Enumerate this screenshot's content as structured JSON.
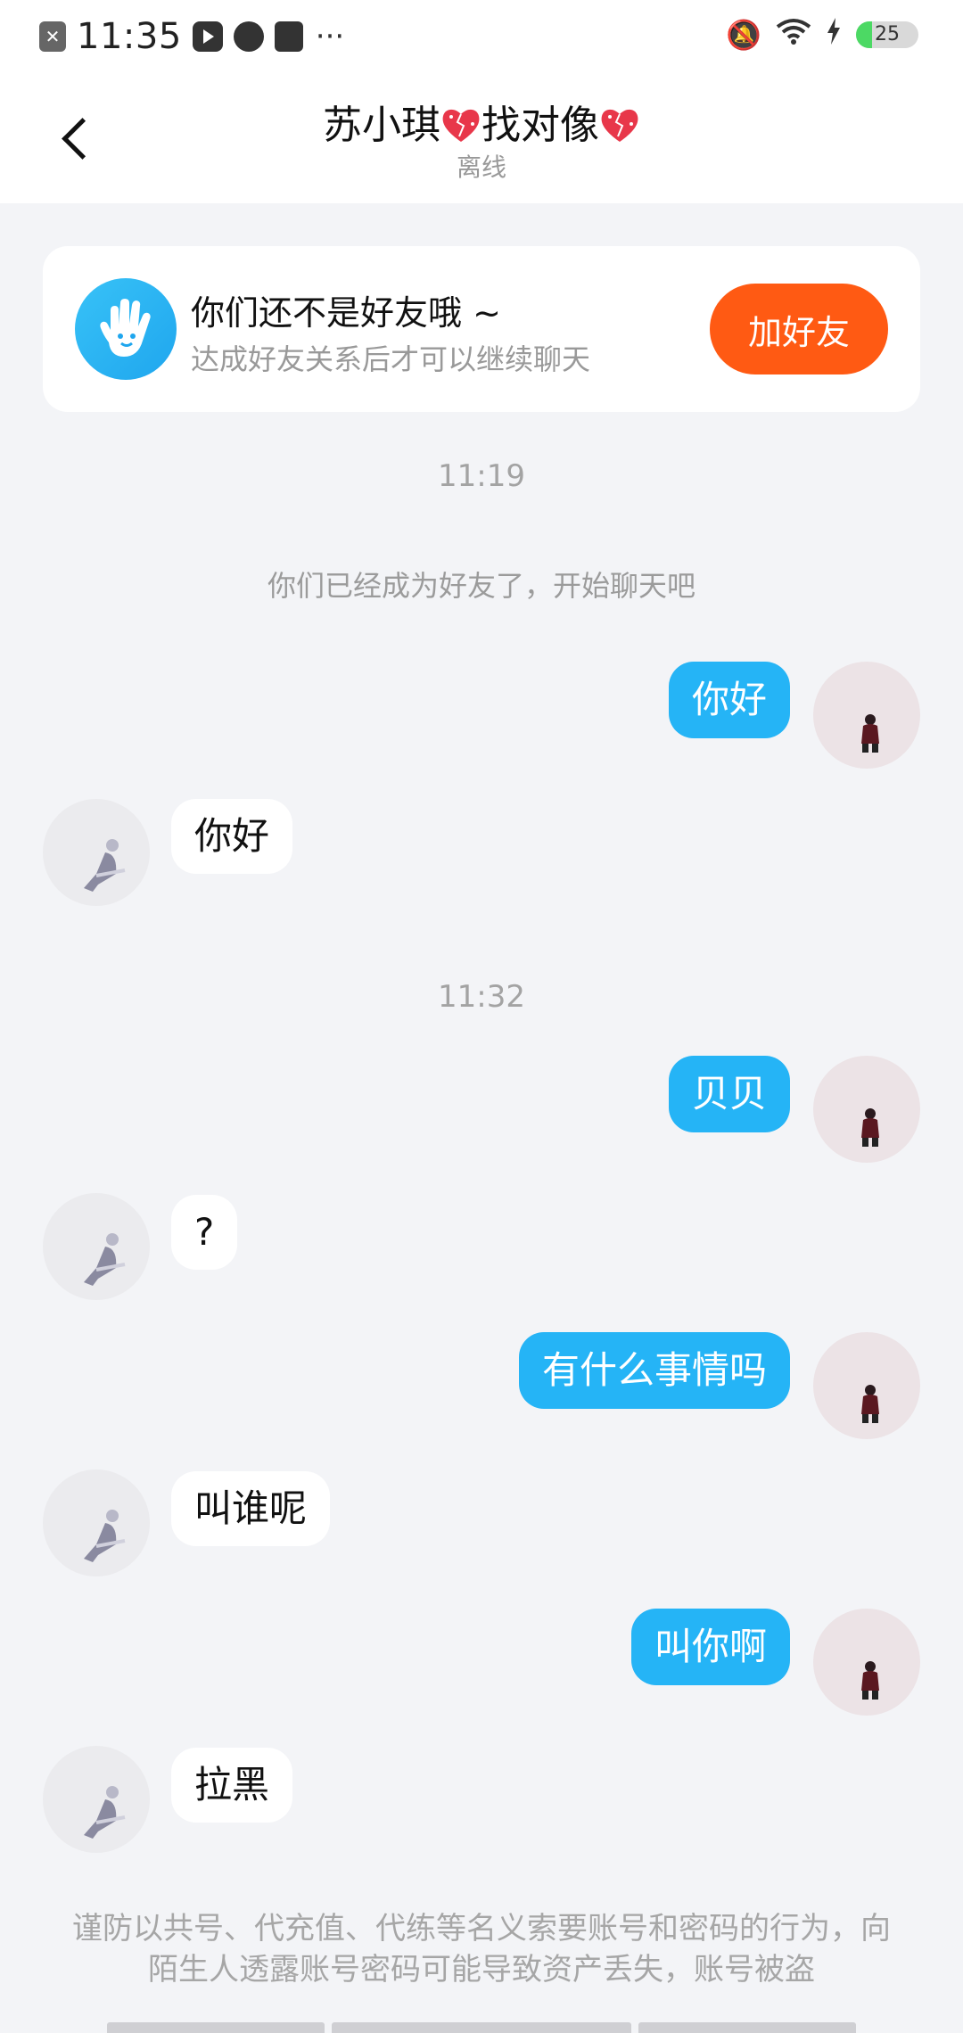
{
  "status_bar": {
    "time": "11:35",
    "battery": "25",
    "more": "···"
  },
  "header": {
    "title": "苏小琪",
    "title2": "找对像",
    "subtitle": "离线"
  },
  "friend_card": {
    "title": "你们还不是好友哦 ~",
    "subtitle": "达成好友关系后才可以继续聊天",
    "button": "加好友"
  },
  "chat": {
    "time1": "11:19",
    "system": "你们已经成为好友了，开始聊天吧",
    "time2": "11:32",
    "messages": [
      {
        "from": "me",
        "text": "你好"
      },
      {
        "from": "other",
        "text": "你好"
      },
      {
        "from": "me",
        "text": "贝贝"
      },
      {
        "from": "other",
        "text": "?"
      },
      {
        "from": "me",
        "text": "有什么事情吗"
      },
      {
        "from": "other",
        "text": "叫谁呢"
      },
      {
        "from": "me",
        "text": "叫你啊"
      },
      {
        "from": "other",
        "text": "拉黑"
      }
    ]
  },
  "footer": {
    "warning": "谨防以共号、代充值、代练等名义索要账号和密码的行为，向陌生人透露账号密码可能导致资产丢失，账号被盗"
  },
  "colors": {
    "accent": "#25b4f6",
    "add_button": "#ff5a13"
  }
}
